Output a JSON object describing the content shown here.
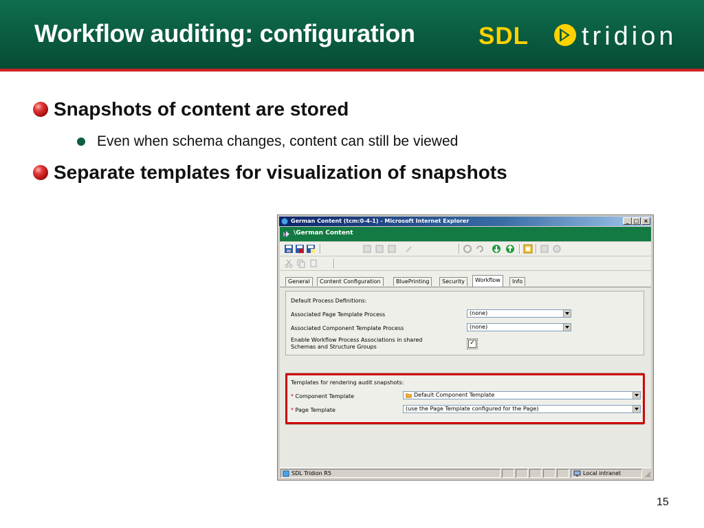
{
  "slide": {
    "title": "Workflow auditing: configuration",
    "logo": {
      "sdl": "SDL",
      "tridion": "tridion"
    },
    "bullets": [
      "Snapshots of content are stored",
      "Even when schema changes, content can still be viewed",
      "Separate templates for visualization of snapshots"
    ],
    "page_number": "15"
  },
  "window": {
    "title": "German Content (tcm:0-4-1) - Microsoft Internet Explorer",
    "app_title": "\\German Content",
    "tabs": [
      "General",
      "Content Configuration",
      "BluePrinting",
      "Security",
      "Workflow",
      "Info"
    ],
    "active_tab": "Workflow",
    "default_process": {
      "heading": "Default Process Definitions:",
      "page_template_label": "Associated Page Template Process",
      "page_template_value": "(none)",
      "component_template_label": "Associated Component Template Process",
      "component_template_value": "(none)",
      "enable_label_line1": "Enable Workflow Process Associations in shared",
      "enable_label_line2": "Schemas and Structure Groups",
      "enable_checked": "✓"
    },
    "audit": {
      "heading": "Templates for rendering audit snapshots:",
      "required_marker": "*",
      "component_template_label": "Component Template",
      "component_template_value": "Default Component Template",
      "page_template_label": "Page Template",
      "page_template_value": "(use the Page Template configured for the Page)"
    },
    "status": {
      "left": "SDL Tridion R5",
      "zone": "Local intranet"
    },
    "colors": {
      "app_bar": "#127a42",
      "highlight": "#cc0000",
      "header": "#0a5a3f"
    },
    "icons": [
      "save-icon",
      "save-close-icon",
      "copy-icon",
      "refresh-icon",
      "checkin-icon",
      "checkout-icon",
      "cut-icon",
      "paste-icon"
    ]
  }
}
